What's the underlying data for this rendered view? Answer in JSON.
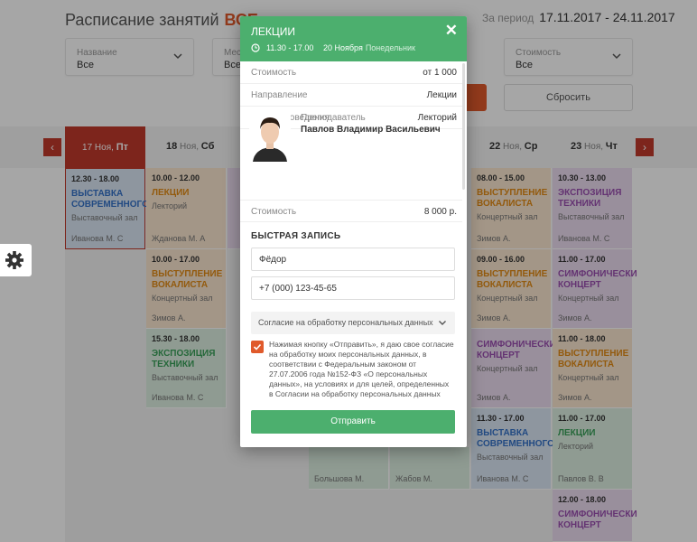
{
  "header": {
    "title": "Расписание занятий",
    "title_highlight": "ВСЕ",
    "period_label": "За период",
    "period_value": "17.11.2017 - 24.11.2017"
  },
  "filters": [
    {
      "label": "Название",
      "value": "Все"
    },
    {
      "label": "Мес",
      "value": "Все"
    },
    {
      "label": "Стоимость",
      "value": "Все"
    }
  ],
  "buttons": {
    "reset": "Сбросить"
  },
  "days": [
    {
      "num": "17",
      "month": "Ноя,",
      "dow": "Пт"
    },
    {
      "num": "18",
      "month": "Ноя,",
      "dow": "Сб"
    },
    {
      "num": "22",
      "month": "Ноя,",
      "dow": "Ср"
    },
    {
      "num": "23",
      "month": "Ноя,",
      "dow": "Чт"
    }
  ],
  "cards": [
    {
      "time": "12.30 - 18.00",
      "name": "ВЫСТАВКА СОВРЕМЕННОГО",
      "place": "Выставочный зал",
      "author": "Иванова М. С"
    },
    {
      "time": "10.00 - 12.00",
      "name": "ЛЕКЦИИ",
      "place": "Лекторий",
      "author": "Жданова М. А"
    },
    {
      "time": "10.00 - 17.00",
      "name": "ВЫСТУПЛЕНИЕ ВОКАЛИСТА",
      "place": "Концертный зал",
      "author": "Зимов А."
    },
    {
      "time": "15.30 - 18.00",
      "name": "ЭКСПОЗИЦИЯ ТЕХНИКИ",
      "place": "Выставочный зал",
      "author": "Иванова М. С"
    },
    {
      "time": "08.00 - 15.00",
      "name": "ВЫСТУПЛЕНИЕ ВОКАЛИСТА",
      "place": "Концертный зал",
      "author": "Зимов А."
    },
    {
      "time": "09.00 - 16.00",
      "name": "ВЫСТУПЛЕНИЕ ВОКАЛИСТА",
      "place": "Концертный зал",
      "author": "Зимов А."
    },
    {
      "time": "",
      "name": "СИМФОНИЧЕСКИ КОНЦЕРТ",
      "place": "Концертный зал",
      "author": "Зимов А."
    },
    {
      "time": "11.30 - 17.00",
      "name": "ВЫСТАВКА СОВРЕМЕННОГО",
      "place": "Выставочный зал",
      "author": "Иванова М. С"
    },
    {
      "time": "10.30 - 13.00",
      "name": "ЭКСПОЗИЦИЯ ТЕХНИКИ",
      "place": "Выставочный зал",
      "author": "Иванова М. С"
    },
    {
      "time": "11.00 - 17.00",
      "name": "СИМФОНИЧЕСКИ КОНЦЕРТ",
      "place": "Концертный зал",
      "author": "Зимов А."
    },
    {
      "time": "11.00 - 18.00",
      "name": "ВЫСТУПЛЕНИЕ ВОКАЛИСТА",
      "place": "Концертный зал",
      "author": "Зимов А."
    },
    {
      "time": "11.00 - 17.00",
      "name": "ЛЕКЦИИ",
      "place": "Лекторий",
      "author": "Павлов В. В"
    },
    {
      "time": "12.00 - 18.00",
      "name": "СИМФОНИЧЕСКИ КОНЦЕРТ",
      "place": "",
      "author": ""
    },
    {
      "time": "",
      "name": "",
      "place": "",
      "author": "Большова М."
    },
    {
      "time": "",
      "name": "",
      "place": "",
      "author": "Жабов М."
    }
  ],
  "modal": {
    "title": "ЛЕКЦИИ",
    "time": "11.30  -  17.00",
    "date": "20 Ноября",
    "weekday": "Понедельник",
    "rows": [
      {
        "k": "Стоимость",
        "v": "от 1 000"
      },
      {
        "k": "Направление",
        "v": "Лекции"
      },
      {
        "k": "Место проведения",
        "v": "Лекторий"
      }
    ],
    "teacher_label": "Преподаватель",
    "teacher_name": "Павлов Владимир Васильевич",
    "price_row": {
      "k": "Стоимость",
      "v": "8 000 р."
    },
    "fast_title": "БЫСТРАЯ ЗАПИСЬ",
    "name_value": "Фёдор",
    "phone_value": "+7 (000) 123-45-65",
    "consent_select": "Согласие на обработку персональных данных",
    "consent_text": "Нажимая кнопку «Отправить», я даю свое согласие на обработку моих персональных данных, в соответствии с Федеральным законом от 27.07.2006 года №152-ФЗ «О персональных данных», на условиях и для целей, определенных в Согласии на обработку персональных данных",
    "submit": "Отправить"
  }
}
